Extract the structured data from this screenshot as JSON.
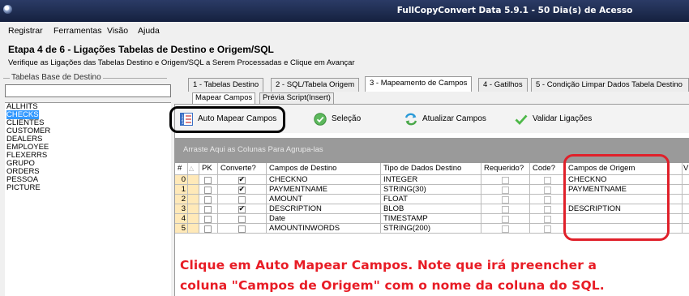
{
  "window": {
    "title": "FullCopyConvert Data 5.9.1 - 50 Dia(s) de Acesso"
  },
  "menu": [
    "Registrar",
    "Ferramentas",
    "Visão",
    "Ajuda"
  ],
  "step": {
    "title": "Etapa 4 de 6 - Ligações Tabelas de Destino e Origem/SQL",
    "subtitle": "Verifique as Ligações das Tabelas Destino e Origem/SQL a Serem Processadas e Clique em Avançar"
  },
  "left": {
    "group_label": "Tabelas Base de Destino",
    "filter_value": "",
    "tables": [
      "ALLHITS",
      "CHECKS",
      "CLIENTES",
      "CUSTOMER",
      "DEALERS",
      "EMPLOYEE",
      "FLEXERRS",
      "GRUPO",
      "ORDERS",
      "PESSOA",
      "PICTURE"
    ],
    "selected": "CHECKS"
  },
  "tabs": [
    {
      "label": "1 - Tabelas Destino"
    },
    {
      "label": "2 - SQL/Tabela Origem"
    },
    {
      "label": "3 - Mapeamento de Campos",
      "active": true
    },
    {
      "label": "4 - Gatilhos"
    },
    {
      "label": "5 - Condição Limpar Dados Tabela Destino"
    }
  ],
  "subtabs": [
    {
      "label": "Mapear Campos",
      "active": true
    },
    {
      "label": "Prévia Script(Insert)"
    }
  ],
  "toolbar": {
    "auto_map": "Auto Mapear Campos",
    "selection": "Seleção",
    "refresh": "Atualizar Campos",
    "validate": "Validar Ligações"
  },
  "groupby_hint": "Arraste Aqui as Colunas Para Agrupa-las",
  "grid": {
    "headers": [
      "#",
      "PK",
      "Converte?",
      "Campos de Destino",
      "Tipo de Dados Destino",
      "Requerido?",
      "Code?",
      "Campos de Origem",
      "V"
    ],
    "rows": [
      {
        "n": "0",
        "pk": false,
        "converte": true,
        "destino": "CHECKNO",
        "tipo": "INTEGER",
        "requerido": false,
        "code": false,
        "origem": "CHECKNO"
      },
      {
        "n": "1",
        "pk": false,
        "converte": true,
        "destino": "PAYMENTNAME",
        "tipo": "STRING(30)",
        "requerido": false,
        "code": false,
        "origem": "PAYMENTNAME"
      },
      {
        "n": "2",
        "pk": false,
        "converte": false,
        "destino": "AMOUNT",
        "tipo": "FLOAT",
        "requerido": false,
        "code": false,
        "origem": ""
      },
      {
        "n": "3",
        "pk": false,
        "converte": true,
        "destino": "DESCRIPTION",
        "tipo": "BLOB",
        "requerido": false,
        "code": false,
        "origem": "DESCRIPTION"
      },
      {
        "n": "4",
        "pk": false,
        "converte": false,
        "destino": "Date",
        "tipo": "TIMESTAMP",
        "requerido": false,
        "code": false,
        "origem": ""
      },
      {
        "n": "5",
        "pk": false,
        "converte": false,
        "destino": "AMOUNTINWORDS",
        "tipo": "STRING(200)",
        "requerido": false,
        "code": false,
        "origem": ""
      }
    ]
  },
  "annotation": {
    "line1": "Clique em Auto Mapear Campos. Note que irá preencher a",
    "line2": "coluna \"Campos de Origem\" com o nome da coluna do SQL.",
    "color": "#e81c25"
  },
  "colors": {
    "titlebar": "#1c2a4d",
    "selection": "#3399ff",
    "highlight_ring": "#e0202a",
    "row_indicator": "#ffe9b8"
  }
}
